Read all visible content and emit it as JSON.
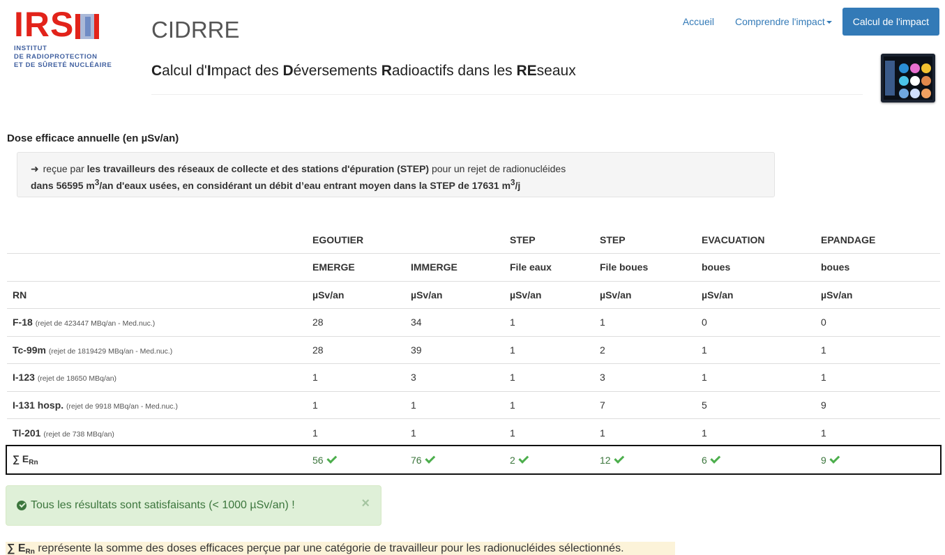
{
  "logo": {
    "letters": "IRS",
    "letter_n": "N",
    "line1": "INSTITUT",
    "line2": "DE RADIOPROTECTION",
    "line3": "ET DE SÛRETÉ NUCLÉAIRE"
  },
  "brand": {
    "title": "CIDRRE",
    "subtitle_parts": [
      {
        "b": "C",
        "t": "alcul d'"
      },
      {
        "b": "I",
        "t": "mpact des "
      },
      {
        "b": "D",
        "t": "éversements "
      },
      {
        "b": "R",
        "t": "adioactifs dans les "
      },
      {
        "b": "RE",
        "t": "seaux"
      }
    ]
  },
  "nav": {
    "home": "Accueil",
    "understand": "Comprendre l'impact",
    "calc": "Calcul de l'impact"
  },
  "section": {
    "title": "Dose efficace annuelle (en µSv/an)",
    "well_line1_pre": " reçue par ",
    "well_line1_bold": "les travailleurs des réseaux de collecte et des stations d'épuration (STEP)",
    "well_line1_post": " pour un rejet de radionucléides",
    "well_line2_a": "dans 56595 m",
    "well_line2_sup1": "3",
    "well_line2_b": "/an d'eaux usées, en considérant un débit d’eau entrant moyen dans la STEP de 17631 m",
    "well_line2_sup2": "3",
    "well_line2_c": "/j"
  },
  "table": {
    "header_row1": [
      "",
      "EGOUTIER",
      "",
      "STEP",
      "STEP",
      "EVACUATION",
      "EPANDAGE"
    ],
    "header_row2": [
      "",
      "EMERGE",
      "IMMERGE",
      "File eaux",
      "File boues",
      "boues",
      "boues"
    ],
    "header_row3": [
      "RN",
      "µSv/an",
      "µSv/an",
      "µSv/an",
      "µSv/an",
      "µSv/an",
      "µSv/an"
    ],
    "rows": [
      {
        "rn": "F-18",
        "note": "(rejet de 423447 MBq/an - Med.nuc.)",
        "values": [
          "28",
          "34",
          "1",
          "1",
          "0",
          "0"
        ]
      },
      {
        "rn": "Tc-99m",
        "note": "(rejet de 1819429 MBq/an - Med.nuc.)",
        "values": [
          "28",
          "39",
          "1",
          "2",
          "1",
          "1"
        ]
      },
      {
        "rn": "I-123",
        "note": "(rejet de 18650 MBq/an)",
        "values": [
          "1",
          "3",
          "1",
          "3",
          "1",
          "1"
        ]
      },
      {
        "rn": "I-131 hosp.",
        "note": "(rejet de 9918 MBq/an - Med.nuc.)",
        "values": [
          "1",
          "1",
          "1",
          "7",
          "5",
          "9"
        ]
      },
      {
        "rn": "Tl-201",
        "note": "(rejet de 738 MBq/an)",
        "values": [
          "1",
          "1",
          "1",
          "1",
          "1",
          "1"
        ]
      }
    ],
    "sum": {
      "label": "∑ E",
      "sub": "Rn",
      "values": [
        "56",
        "76",
        "2",
        "12",
        "6",
        "9"
      ]
    }
  },
  "alert": {
    "text": "Tous les résultats sont satisfaisants (< 1000 µSv/an) !",
    "close": "×"
  },
  "footnote": {
    "sigma": "∑ E",
    "sub": "Rn",
    "text": " représente la somme des doses efficaces perçue par une catégorie de travailleur pour les radionucléides sélectionnés."
  },
  "colors": {
    "brand_red": "#e2231a",
    "link_blue": "#337ab7",
    "success_green": "#3c763d",
    "alert_bg": "#dff0d8",
    "footnote_bg": "#fcf3d9"
  },
  "icons": {
    "arrow": "arrow-right-icon",
    "check": "check-icon",
    "ok": "check-circle-icon",
    "close": "close-icon",
    "caret": "caret-down-icon"
  }
}
